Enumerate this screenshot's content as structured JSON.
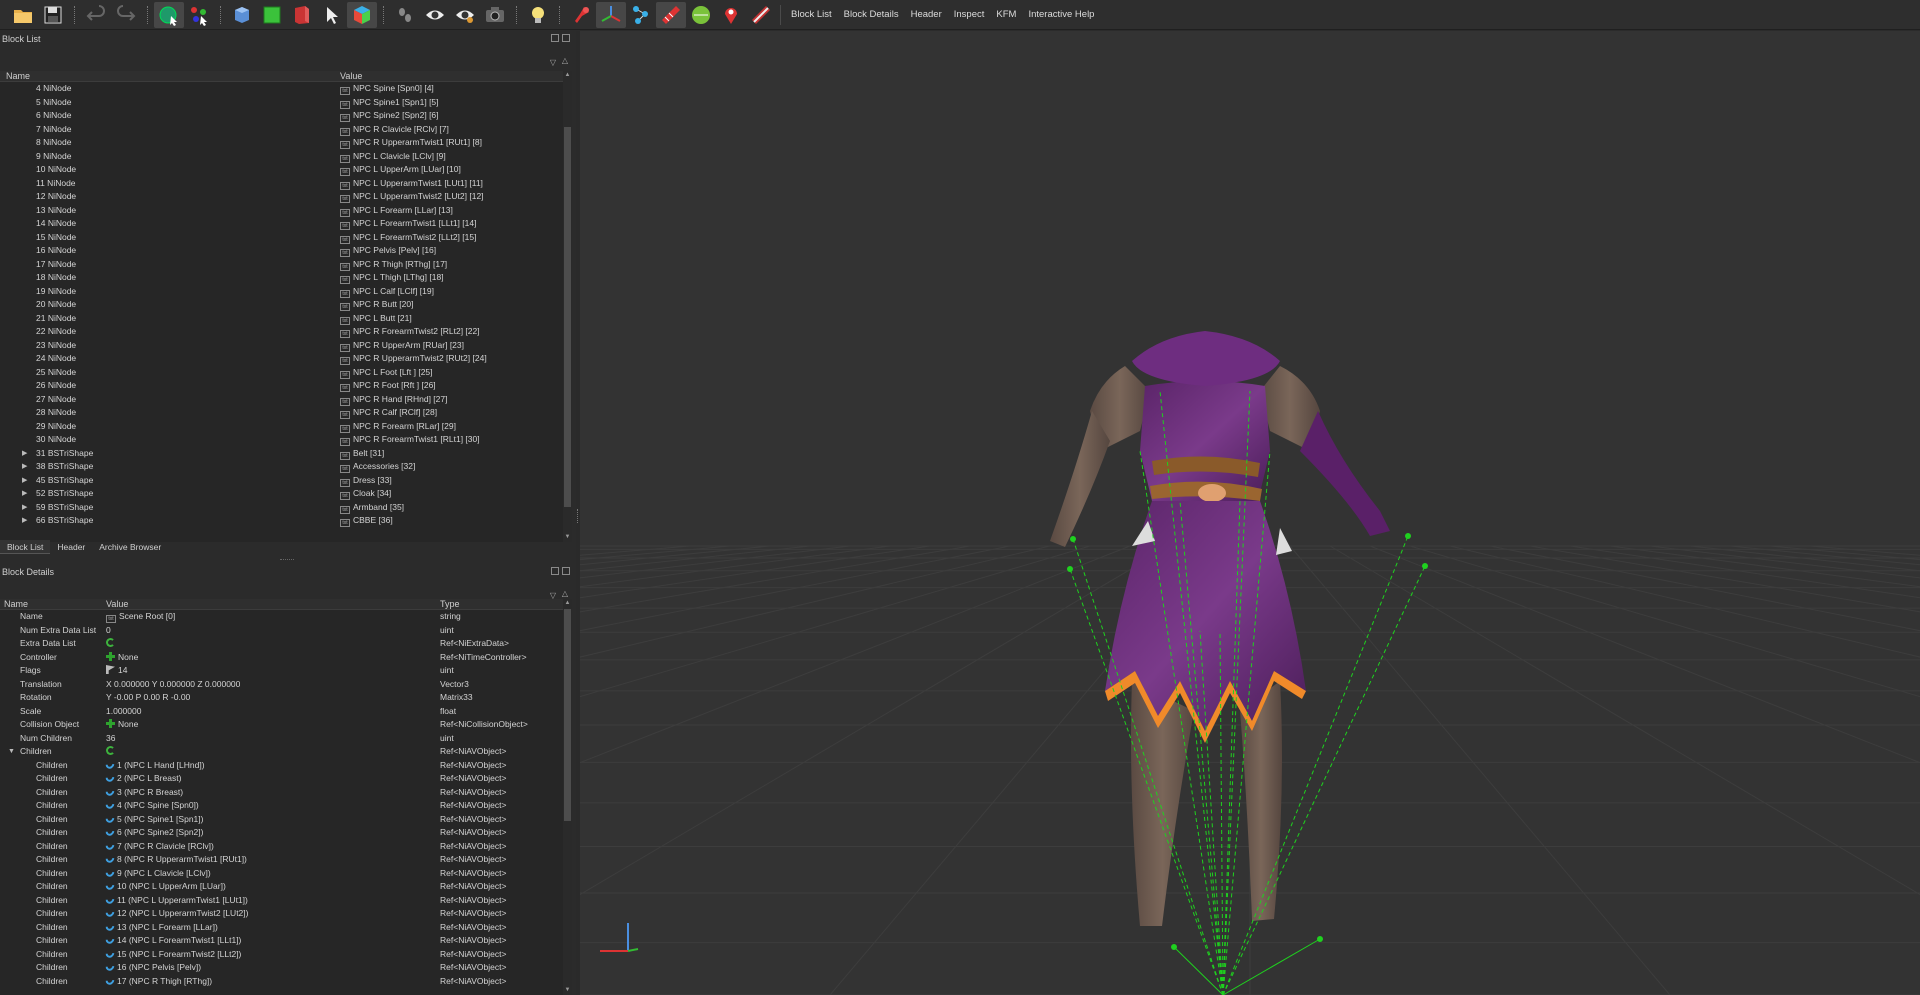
{
  "toolbar": {
    "menu_items": [
      "Block List",
      "Block Details",
      "Header",
      "Inspect",
      "KFM",
      "Interactive Help"
    ]
  },
  "block_list": {
    "title": "Block List",
    "columns": [
      "Name",
      "Value"
    ],
    "rows": [
      {
        "name": "4 NiNode",
        "value": "NPC Spine [Spn0] [4]",
        "expandable": false
      },
      {
        "name": "5 NiNode",
        "value": "NPC Spine1 [Spn1] [5]",
        "expandable": false
      },
      {
        "name": "6 NiNode",
        "value": "NPC Spine2 [Spn2] [6]",
        "expandable": false
      },
      {
        "name": "7 NiNode",
        "value": "NPC R Clavicle [RClv] [7]",
        "expandable": false
      },
      {
        "name": "8 NiNode",
        "value": "NPC R UpperarmTwist1 [RUt1] [8]",
        "expandable": false
      },
      {
        "name": "9 NiNode",
        "value": "NPC L Clavicle [LClv] [9]",
        "expandable": false
      },
      {
        "name": "10 NiNode",
        "value": "NPC L UpperArm [LUar] [10]",
        "expandable": false
      },
      {
        "name": "11 NiNode",
        "value": "NPC L UpperarmTwist1 [LUt1] [11]",
        "expandable": false
      },
      {
        "name": "12 NiNode",
        "value": "NPC L UpperarmTwist2 [LUt2] [12]",
        "expandable": false
      },
      {
        "name": "13 NiNode",
        "value": "NPC L Forearm [LLar] [13]",
        "expandable": false
      },
      {
        "name": "14 NiNode",
        "value": "NPC L ForearmTwist1 [LLt1] [14]",
        "expandable": false
      },
      {
        "name": "15 NiNode",
        "value": "NPC L ForearmTwist2 [LLt2] [15]",
        "expandable": false
      },
      {
        "name": "16 NiNode",
        "value": "NPC Pelvis [Pelv] [16]",
        "expandable": false
      },
      {
        "name": "17 NiNode",
        "value": "NPC R Thigh [RThg] [17]",
        "expandable": false
      },
      {
        "name": "18 NiNode",
        "value": "NPC L Thigh [LThg] [18]",
        "expandable": false
      },
      {
        "name": "19 NiNode",
        "value": "NPC L Calf [LClf] [19]",
        "expandable": false
      },
      {
        "name": "20 NiNode",
        "value": "NPC R Butt [20]",
        "expandable": false
      },
      {
        "name": "21 NiNode",
        "value": "NPC L Butt [21]",
        "expandable": false
      },
      {
        "name": "22 NiNode",
        "value": "NPC R ForearmTwist2 [RLt2] [22]",
        "expandable": false
      },
      {
        "name": "23 NiNode",
        "value": "NPC R UpperArm [RUar] [23]",
        "expandable": false
      },
      {
        "name": "24 NiNode",
        "value": "NPC R UpperarmTwist2 [RUt2] [24]",
        "expandable": false
      },
      {
        "name": "25 NiNode",
        "value": "NPC L Foot [Lft ] [25]",
        "expandable": false
      },
      {
        "name": "26 NiNode",
        "value": "NPC R Foot [Rft ] [26]",
        "expandable": false
      },
      {
        "name": "27 NiNode",
        "value": "NPC R Hand [RHnd] [27]",
        "expandable": false
      },
      {
        "name": "28 NiNode",
        "value": "NPC R Calf [RClf] [28]",
        "expandable": false
      },
      {
        "name": "29 NiNode",
        "value": "NPC R Forearm [RLar] [29]",
        "expandable": false
      },
      {
        "name": "30 NiNode",
        "value": "NPC R ForearmTwist1 [RLt1] [30]",
        "expandable": false
      },
      {
        "name": "31 BSTriShape",
        "value": "Belt [31]",
        "expandable": true
      },
      {
        "name": "38 BSTriShape",
        "value": "Accessories [32]",
        "expandable": true
      },
      {
        "name": "45 BSTriShape",
        "value": "Dress [33]",
        "expandable": true
      },
      {
        "name": "52 BSTriShape",
        "value": "Cloak [34]",
        "expandable": true
      },
      {
        "name": "59 BSTriShape",
        "value": "Armband [35]",
        "expandable": true
      },
      {
        "name": "66 BSTriShape",
        "value": "CBBE [36]",
        "expandable": true
      }
    ],
    "tabs": [
      "Block List",
      "Header",
      "Archive Browser"
    ]
  },
  "block_details": {
    "title": "Block Details",
    "columns": [
      "Name",
      "Value",
      "Type"
    ],
    "rows": [
      {
        "name": "Name",
        "icon": "text",
        "value": "Scene Root [0]",
        "type": "string",
        "indent": 1
      },
      {
        "name": "Num Extra Data List",
        "icon": "",
        "value": "0",
        "type": "uint",
        "indent": 1
      },
      {
        "name": "Extra Data List",
        "icon": "refresh",
        "value": "",
        "type": "Ref<NiExtraData>",
        "indent": 1
      },
      {
        "name": "Controller",
        "icon": "plus",
        "value": "None",
        "type": "Ref<NiTimeController>",
        "indent": 1
      },
      {
        "name": "Flags",
        "icon": "flag",
        "value": "14",
        "type": "uint",
        "indent": 1
      },
      {
        "name": "Translation",
        "icon": "",
        "value": "X 0.000000 Y 0.000000 Z 0.000000",
        "type": "Vector3",
        "indent": 1
      },
      {
        "name": "Rotation",
        "icon": "",
        "value": "Y -0.00 P 0.00 R -0.00",
        "type": "Matrix33",
        "indent": 1
      },
      {
        "name": "Scale",
        "icon": "",
        "value": "1.000000",
        "type": "float",
        "indent": 1
      },
      {
        "name": "Collision Object",
        "icon": "plus",
        "value": "None",
        "type": "Ref<NiCollisionObject>",
        "indent": 1
      },
      {
        "name": "Num Children",
        "icon": "",
        "value": "36",
        "type": "uint",
        "indent": 1
      },
      {
        "name": "Children",
        "icon": "refresh",
        "value": "",
        "type": "Ref<NiAVObject>",
        "indent": 1,
        "expanded": true
      },
      {
        "name": "Children",
        "icon": "link",
        "value": "1 (NPC L Hand [LHnd])",
        "type": "Ref<NiAVObject>",
        "indent": 2
      },
      {
        "name": "Children",
        "icon": "link",
        "value": "2 (NPC L Breast)",
        "type": "Ref<NiAVObject>",
        "indent": 2
      },
      {
        "name": "Children",
        "icon": "link",
        "value": "3 (NPC R Breast)",
        "type": "Ref<NiAVObject>",
        "indent": 2
      },
      {
        "name": "Children",
        "icon": "link",
        "value": "4 (NPC Spine [Spn0])",
        "type": "Ref<NiAVObject>",
        "indent": 2
      },
      {
        "name": "Children",
        "icon": "link",
        "value": "5 (NPC Spine1 [Spn1])",
        "type": "Ref<NiAVObject>",
        "indent": 2
      },
      {
        "name": "Children",
        "icon": "link",
        "value": "6 (NPC Spine2 [Spn2])",
        "type": "Ref<NiAVObject>",
        "indent": 2
      },
      {
        "name": "Children",
        "icon": "link",
        "value": "7 (NPC R Clavicle [RClv])",
        "type": "Ref<NiAVObject>",
        "indent": 2
      },
      {
        "name": "Children",
        "icon": "link",
        "value": "8 (NPC R UpperarmTwist1 [RUt1])",
        "type": "Ref<NiAVObject>",
        "indent": 2
      },
      {
        "name": "Children",
        "icon": "link",
        "value": "9 (NPC L Clavicle [LClv])",
        "type": "Ref<NiAVObject>",
        "indent": 2
      },
      {
        "name": "Children",
        "icon": "link",
        "value": "10 (NPC L UpperArm [LUar])",
        "type": "Ref<NiAVObject>",
        "indent": 2
      },
      {
        "name": "Children",
        "icon": "link",
        "value": "11 (NPC L UpperarmTwist1 [LUt1])",
        "type": "Ref<NiAVObject>",
        "indent": 2
      },
      {
        "name": "Children",
        "icon": "link",
        "value": "12 (NPC L UpperarmTwist2 [LUt2])",
        "type": "Ref<NiAVObject>",
        "indent": 2
      },
      {
        "name": "Children",
        "icon": "link",
        "value": "13 (NPC L Forearm [LLar])",
        "type": "Ref<NiAVObject>",
        "indent": 2
      },
      {
        "name": "Children",
        "icon": "link",
        "value": "14 (NPC L ForearmTwist1 [LLt1])",
        "type": "Ref<NiAVObject>",
        "indent": 2
      },
      {
        "name": "Children",
        "icon": "link",
        "value": "15 (NPC L ForearmTwist2 [LLt2])",
        "type": "Ref<NiAVObject>",
        "indent": 2
      },
      {
        "name": "Children",
        "icon": "link",
        "value": "16 (NPC Pelvis [Pelv])",
        "type": "Ref<NiAVObject>",
        "indent": 2
      },
      {
        "name": "Children",
        "icon": "link",
        "value": "17 (NPC R Thigh [RThg])",
        "type": "Ref<NiAVObject>",
        "indent": 2
      }
    ]
  },
  "colors": {
    "accent_green": "#2ea32e",
    "link_blue": "#3e9fe0",
    "bone_green": "#1fd11f",
    "dress_purple": "#6a2d7a",
    "trim_orange": "#f08a2a"
  }
}
